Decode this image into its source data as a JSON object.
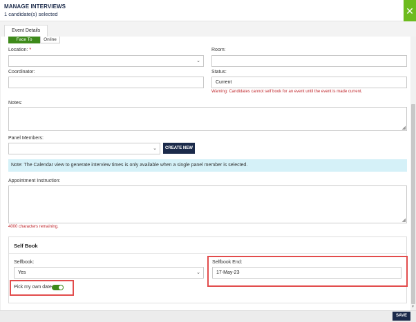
{
  "header": {
    "title": "MANAGE INTERVIEWS",
    "subtitle": "1 candidate(s) selected",
    "close_symbol": "✕",
    "accent_color": "#6dbb1e"
  },
  "tabs": [
    {
      "label": "Event Details",
      "active": true
    }
  ],
  "event_type": {
    "options": [
      "Face To Face",
      "Online"
    ],
    "selected": "Face To Face"
  },
  "form": {
    "location": {
      "label": "Location:",
      "required_marker": "*",
      "value": ""
    },
    "room": {
      "label": "Room:",
      "value": ""
    },
    "coordinator": {
      "label": "Coordinator:",
      "value": ""
    },
    "status": {
      "label": "Status:",
      "value": "Current",
      "warning": "Warning: Candidates cannot self book for an event until the event is made current."
    },
    "notes": {
      "label": "Notes:",
      "value": ""
    },
    "panel_members": {
      "label": "Panel Members:",
      "value": "",
      "create_label": "CREATE NEW"
    },
    "note_text": "Note: The Calendar view to generate interview times is only available when a single panel member is selected.",
    "appointment_instruction": {
      "label": "Appointment Instruction:",
      "value": "",
      "remaining": "4000 characters remaining."
    }
  },
  "selfbook": {
    "title": "Self Book",
    "selfbook_label": "Selfbook:",
    "selfbook_value": "Yes",
    "end_label": "Selfbook End:",
    "end_value": "17-May-23",
    "pick_label": "Pick my own date",
    "pick_on": true
  },
  "footer": {
    "save_label": "SAVE"
  },
  "icons": {
    "dropdown": "chevron-down-icon",
    "close": "close-icon",
    "resize": "resize-grip-icon"
  }
}
